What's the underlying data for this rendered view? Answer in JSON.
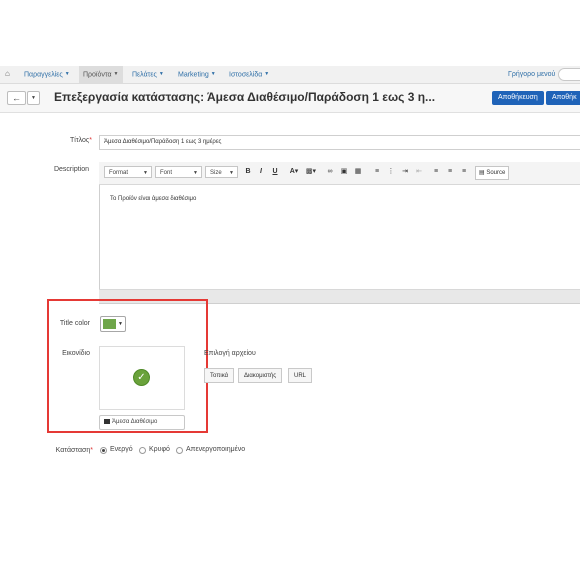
{
  "nav": {
    "home_icon": "home-icon",
    "items": [
      {
        "label": "Παραγγελίες",
        "active": false
      },
      {
        "label": "Προϊόντα",
        "active": true
      },
      {
        "label": "Πελάτες",
        "active": false
      },
      {
        "label": "Marketing",
        "active": false
      },
      {
        "label": "Ιστοσελίδα",
        "active": false
      }
    ],
    "quick_menu": "Γρήγορο μενού"
  },
  "header": {
    "title": "Επεξεργασία κατάστασης: Άμεσα Διαθέσιμο/Παράδοση 1 εως 3 η...",
    "save_label": "Αποθήκευση",
    "save2_label": "Αποθήκ",
    "back_icon": "arrow-left-icon",
    "accent_color": "#1f63b8"
  },
  "form": {
    "title_label": "Τίτλος",
    "title_value": "Άμεσα Διαθέσιμο/Παράδοση 1 εως 3 ημέρες",
    "description_label": "Description",
    "editor": {
      "format": "Format",
      "font": "Font",
      "size": "Size",
      "source": "Source",
      "body": "Το Προϊόν είναι άμεσα διαθέσιμο"
    },
    "title_color_label": "Title color",
    "title_color_value": "#6fa64a",
    "image_label": "Εικονίδιο",
    "image_icon": "check-circle-icon",
    "image_caption": "Άμεσα Διαθέσιμο",
    "file_choice_label": "Επιλογή αρχείου",
    "file_buttons": [
      "Τοπικά",
      "Διακομιστής",
      "URL"
    ],
    "status_label": "Κατάσταση",
    "status_options": [
      "Ενεργό",
      "Κρυφό",
      "Απενεργοποιημένο"
    ],
    "status_selected": "Ενεργό"
  },
  "highlight_color": "#e53935"
}
